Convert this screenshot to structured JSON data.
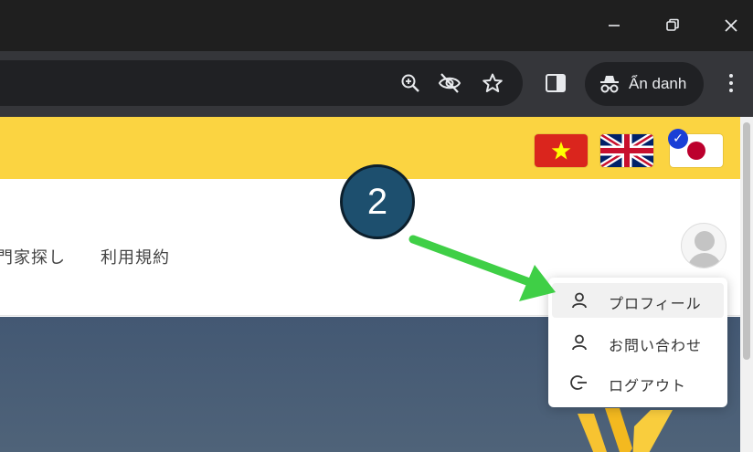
{
  "browser": {
    "incognito_label": "Ẩn danh",
    "colors": {
      "titlebar": "#1f1f1f",
      "toolbar": "#35363a",
      "omnibox": "#202124"
    },
    "toolbar_icons": [
      "zoom-icon",
      "eye-off-icon",
      "star-icon",
      "side-panel-icon",
      "incognito-icon",
      "more-vert-icon"
    ]
  },
  "language_bar": {
    "color": "#fbd441",
    "flags": [
      {
        "name": "vietnam-flag",
        "selected": false
      },
      {
        "name": "uk-flag",
        "selected": false
      },
      {
        "name": "japan-flag",
        "selected": true
      }
    ]
  },
  "nav": {
    "items": [
      {
        "label": "専門家探し",
        "visible_text": "門家探し"
      },
      {
        "label": "利用規約"
      }
    ]
  },
  "dropdown": {
    "items": [
      {
        "label": "プロフィール",
        "icon": "user-icon",
        "highlighted": true
      },
      {
        "label": "お問い合わせ",
        "icon": "user-icon",
        "highlighted": false
      },
      {
        "label": "ログアウト",
        "icon": "logout-icon",
        "highlighted": false
      }
    ]
  },
  "annotation": {
    "step_number": "2",
    "arrow_color": "#3fcf46",
    "badge_color": "#1d4f6e"
  }
}
